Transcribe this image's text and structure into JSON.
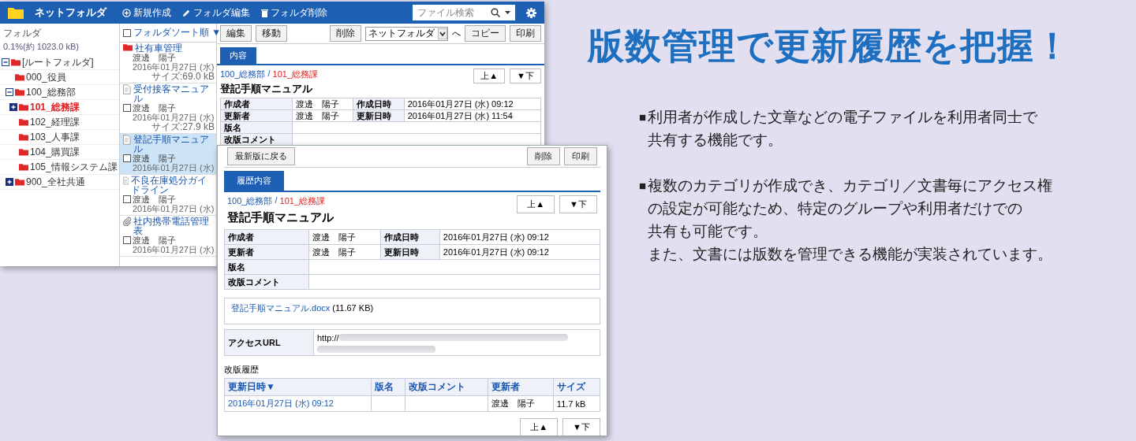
{
  "back_window": {
    "header": {
      "title": "ネットフォルダ",
      "actions": [
        {
          "kind": "add",
          "label": "新規作成"
        },
        {
          "kind": "edit",
          "label": "フォルダ編集"
        },
        {
          "kind": "delete",
          "label": "フォルダ削除"
        }
      ],
      "search": {
        "placeholder": "ファイル検索"
      }
    },
    "tree": {
      "title": "フォルダ",
      "usage": "0.1%(約 1023.0 kB)",
      "nodes": [
        {
          "label": "[ルートフォルダ]",
          "expanded": true,
          "selected": false,
          "children": [
            {
              "label": "000_役員",
              "selected": false
            },
            {
              "label": "100_総務部",
              "expanded": true,
              "selected": false,
              "children": [
                {
                  "label": "101_総務課",
                  "expanded": false,
                  "selected": true
                },
                {
                  "label": "102_経理課",
                  "selected": false
                },
                {
                  "label": "103_人事課",
                  "selected": false
                },
                {
                  "label": "104_購買課",
                  "selected": false
                },
                {
                  "label": "105_情報システム課",
                  "selected": false
                }
              ]
            },
            {
              "label": "900_全社共通",
              "expanded": false,
              "selected": false
            }
          ]
        }
      ]
    },
    "list": {
      "sort": {
        "checked": false,
        "label": "フォルダソート順 ▼"
      },
      "items": [
        {
          "kind": "folder",
          "title": "社有車管理",
          "author": "渡邊　陽子",
          "date": "2016年01月27日 (水)",
          "size": "サイズ:69.0 kB",
          "selected": false
        },
        {
          "kind": "document",
          "title": "受付接客マニュアル",
          "checked": false,
          "author": "渡邊　陽子",
          "date": "2016年01月27日 (水)",
          "size": "サイズ:27.9 kB",
          "selected": false
        },
        {
          "kind": "document",
          "title": "登記手順マニュアル",
          "checked": false,
          "author": "渡邊　陽子",
          "date": "2016年01月27日 (水)",
          "selected": true
        },
        {
          "kind": "document",
          "title": "不良在庫処分ガイドライン",
          "checked": false,
          "author": "渡邊　陽子",
          "date": "2016年01月27日 (水)",
          "selected": false
        },
        {
          "kind": "attachment",
          "title": "社内携帯電話管理表",
          "checked": false,
          "author": "渡邊　陽子",
          "date": "2016年01月27日 (水)",
          "selected": false
        }
      ]
    },
    "detail": {
      "toolbar_left": [
        {
          "kind": "button",
          "label": "編集"
        },
        {
          "kind": "button",
          "label": "移動"
        }
      ],
      "toolbar_right": [
        {
          "kind": "button",
          "label": "削除"
        },
        {
          "kind": "select",
          "label": "ネットフォルダ"
        },
        {
          "kind": "text",
          "label": "へ"
        },
        {
          "kind": "button",
          "label": "コピー"
        },
        {
          "kind": "button",
          "label": "印刷"
        }
      ],
      "tabs": [
        {
          "label": "内容",
          "selected": true
        }
      ],
      "breadcrumb": [
        {
          "label": "100_総務部",
          "current": false
        },
        {
          "label": "101_総務課",
          "current": true
        }
      ],
      "separator": "/",
      "title": "登記手順マニュアル",
      "nav": [
        "上▲",
        "▼下"
      ],
      "properties": [
        {
          "label": "作成者",
          "value": "渡邊　陽子",
          "label2": "作成日時",
          "value2": "2016年01月27日 (水) 09:12"
        },
        {
          "label": "更新者",
          "value": "渡邊　陽子",
          "label2": "更新日時",
          "value2": "2016年01月27日 (水) 11:54"
        },
        {
          "label": "版名"
        },
        {
          "label": "改版コメント"
        }
      ]
    }
  },
  "front_window": {
    "toolbar_left": [
      {
        "kind": "button",
        "label": "最新版に戻る"
      }
    ],
    "toolbar_right": [
      {
        "kind": "button",
        "label": "削除"
      },
      {
        "kind": "button",
        "label": "印刷"
      }
    ],
    "tabs": [
      {
        "label": "履歴内容",
        "selected": true
      }
    ],
    "breadcrumb": [
      {
        "label": "100_総務部",
        "current": false
      },
      {
        "label": "101_総務課",
        "current": true
      }
    ],
    "separator": "/",
    "title": "登記手順マニュアル",
    "nav": [
      "上▲",
      "▼下"
    ],
    "properties": [
      {
        "label": "作成者",
        "value": "渡邊　陽子",
        "label2": "作成日時",
        "value2": "2016年01月27日 (水) 09:12"
      },
      {
        "label": "更新者",
        "value": "渡邊　陽子",
        "label2": "更新日時",
        "value2": "2016年01月27日 (水) 09:12"
      },
      {
        "label": "版名"
      },
      {
        "label": "改版コメント"
      }
    ],
    "file": {
      "name": "登記手順マニュアル.docx",
      "size": "(11.67 KB)"
    },
    "access_url": {
      "label": "アクセスURL",
      "value": "http://"
    },
    "history": {
      "title": "改版履歴",
      "columns": [
        "更新日時▼",
        "版名",
        "改版コメント",
        "更新者",
        "サイズ"
      ],
      "rows": [
        {
          "updated": "2016年01月27日 (水) 09:12",
          "updater": "渡邊　陽子",
          "size": "11.7 kB"
        }
      ],
      "nav": [
        "上▲",
        "▼下"
      ]
    }
  },
  "slide": {
    "headline": "版数管理で更新履歴を把握！",
    "bullets": [
      {
        "marker": "■",
        "lines": [
          "利用者が作成した文章などの電子ファイルを利用者同士で",
          "共有する機能です。"
        ]
      },
      {
        "marker": "■",
        "lines": [
          "複数のカテゴリが作成でき、カテゴリ／文書毎にアクセス権",
          "の設定が可能なため、特定のグループや利用者だけでの",
          "共有も可能です。",
          "また、文書には版数を管理できる機能が実装されています。"
        ]
      }
    ]
  }
}
